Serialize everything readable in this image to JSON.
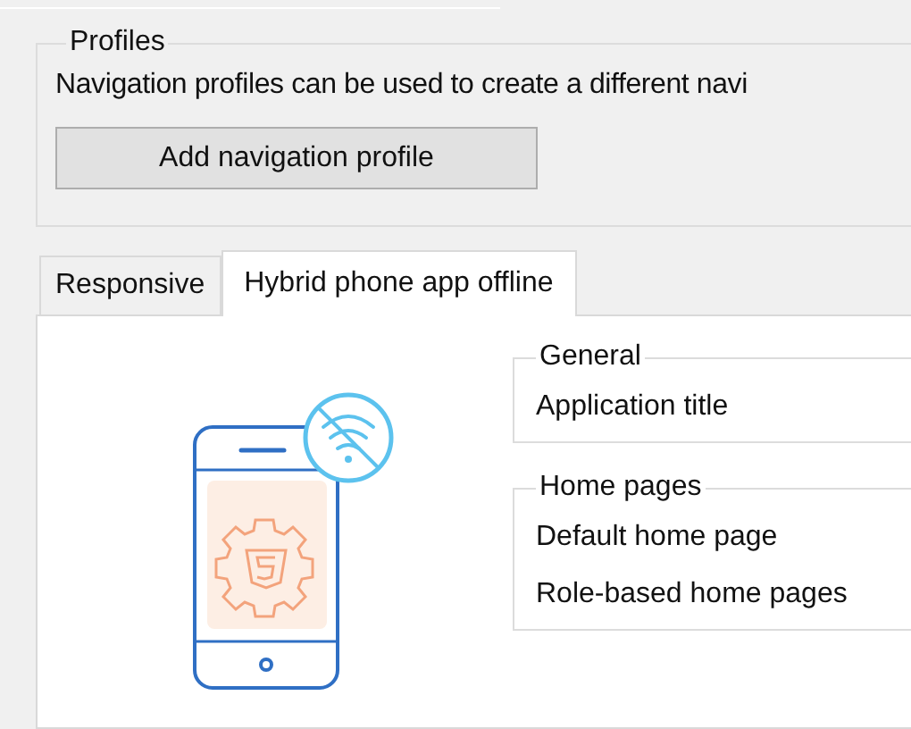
{
  "profiles": {
    "title": "Profiles",
    "description": "Navigation profiles can be used to create a different navi",
    "button": "Add navigation profile"
  },
  "tabs": [
    {
      "label": "Responsive",
      "selected": false
    },
    {
      "label": "Hybrid phone app offline",
      "selected": true
    }
  ],
  "groups": [
    {
      "title": "General",
      "items": [
        "Application title"
      ]
    },
    {
      "title": "Home pages",
      "items": [
        "Default home page",
        "Role-based home pages"
      ]
    }
  ]
}
